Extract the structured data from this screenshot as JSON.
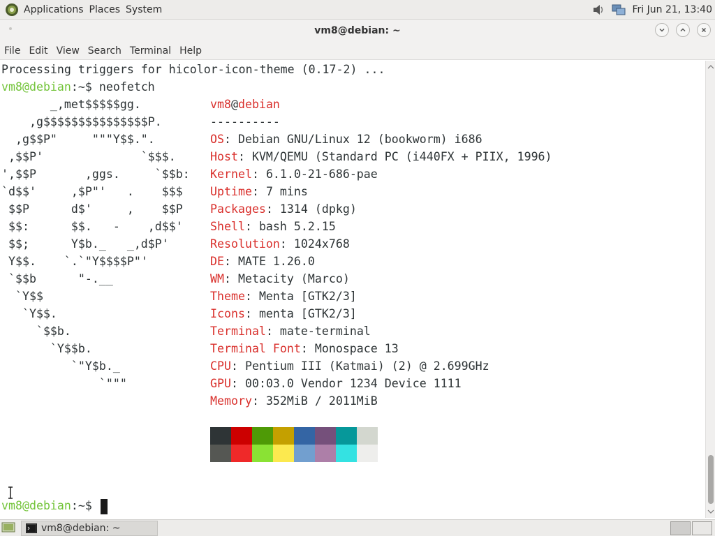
{
  "top_panel": {
    "menus": [
      "Applications",
      "Places",
      "System"
    ],
    "clock": "Fri Jun 21, 13:40"
  },
  "window": {
    "title": "vm8@debian: ~"
  },
  "menubar": {
    "items": [
      "File",
      "Edit",
      "View",
      "Search",
      "Terminal",
      "Help"
    ]
  },
  "terminal": {
    "line_processing": "Processing triggers for hicolor-icon-theme (0.17-2) ...",
    "prompt_user": "vm8@debian",
    "prompt_sep": ":~$ ",
    "command": "neofetch",
    "ascii": [
      "       _,met$$$$$gg.",
      "    ,g$$$$$$$$$$$$$$$P.",
      "  ,g$$P\"     \"\"\"Y$$.\".",
      " ,$$P'              `$$$.",
      "',$$P       ,ggs.     `$$b:",
      "`d$$'     ,$P\"'   .    $$$",
      " $$P      d$'     ,    $$P",
      " $$:      $$.   -    ,d$$'",
      " $$;      Y$b._   _,d$P'",
      " Y$$.    `.`\"Y$$$$P\"'",
      " `$$b      \"-.__",
      "  `Y$$",
      "   `Y$$.",
      "     `$$b.",
      "       `Y$$b.",
      "          `\"Y$b._",
      "              `\"\"\""
    ],
    "info_header_user": "vm8",
    "info_header_at": "@",
    "info_header_host": "debian",
    "info_separator": "----------",
    "info": [
      {
        "label": "OS",
        "value": "Debian GNU/Linux 12 (bookworm) i686"
      },
      {
        "label": "Host",
        "value": "KVM/QEMU (Standard PC (i440FX + PIIX, 1996)"
      },
      {
        "label": "Kernel",
        "value": "6.1.0-21-686-pae"
      },
      {
        "label": "Uptime",
        "value": "7 mins"
      },
      {
        "label": "Packages",
        "value": "1314 (dpkg)"
      },
      {
        "label": "Shell",
        "value": "bash 5.2.15"
      },
      {
        "label": "Resolution",
        "value": "1024x768"
      },
      {
        "label": "DE",
        "value": "MATE 1.26.0"
      },
      {
        "label": "WM",
        "value": "Metacity (Marco)"
      },
      {
        "label": "Theme",
        "value": "Menta [GTK2/3]"
      },
      {
        "label": "Icons",
        "value": "menta [GTK2/3]"
      },
      {
        "label": "Terminal",
        "value": "mate-terminal"
      },
      {
        "label": "Terminal Font",
        "value": "Monospace 13"
      },
      {
        "label": "CPU",
        "value": "Pentium III (Katmai) (2) @ 2.699GHz"
      },
      {
        "label": "GPU",
        "value": "00:03.0 Vendor 1234 Device 1111"
      },
      {
        "label": "Memory",
        "value": "352MiB / 2011MiB"
      }
    ],
    "palette_dark": [
      "#2e3436",
      "#cc0000",
      "#4e9a06",
      "#c4a000",
      "#3465a4",
      "#75507b",
      "#06989a",
      "#d3d7cf"
    ],
    "palette_bright": [
      "#555753",
      "#ef2929",
      "#8ae234",
      "#fce94f",
      "#729fcf",
      "#ad7fa8",
      "#34e2e2",
      "#eeeeec"
    ]
  },
  "taskbar": {
    "task_label": "vm8@debian: ~"
  }
}
